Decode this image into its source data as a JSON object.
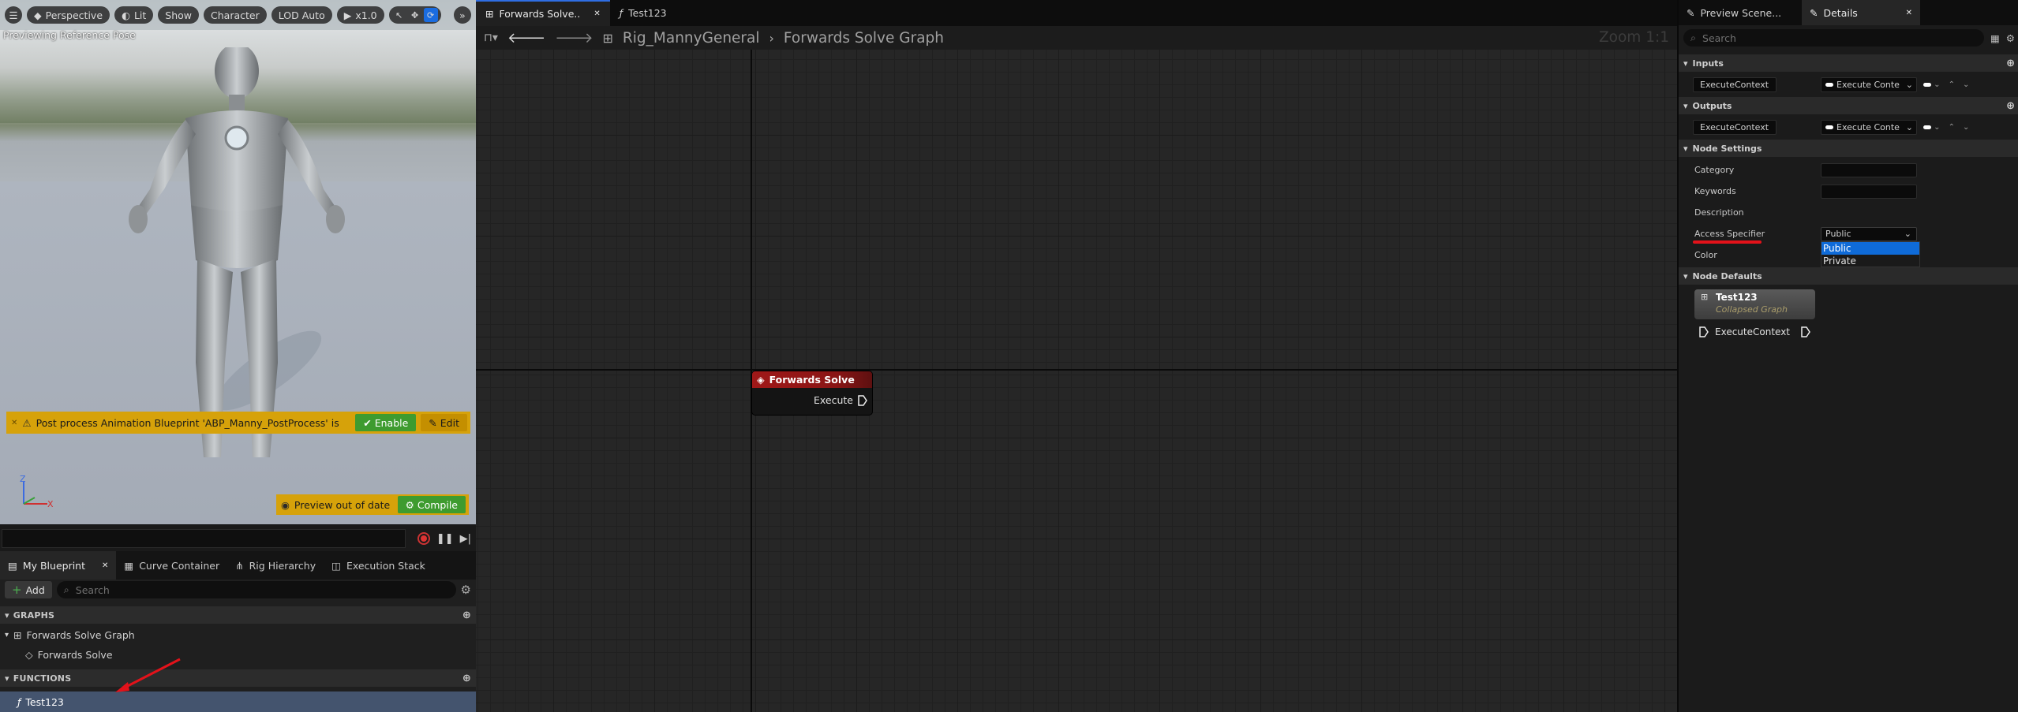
{
  "viewport": {
    "toolbar": {
      "menu_icon": "hamburger-icon",
      "perspective": "Perspective",
      "lit": "Lit",
      "show": "Show",
      "character": "Character",
      "lod": "LOD Auto",
      "speed": "x1.0"
    },
    "preview_label": "Previewing Reference Pose",
    "warning": {
      "text": "Post process Animation Blueprint 'ABP_Manny_PostProcess' is",
      "enable": "Enable",
      "edit": "Edit"
    },
    "preview_out_of_date": {
      "text": "Preview out of date",
      "compile": "Compile"
    },
    "axis": {
      "z": "Z",
      "x": "X"
    },
    "colors": {
      "warning": "#d6a20a",
      "compile": "#3e9b2f"
    }
  },
  "my_blueprint": {
    "tabs": [
      {
        "label": "My Blueprint",
        "icon": "blueprint-icon"
      },
      {
        "label": "Curve Container",
        "icon": "curve-icon"
      },
      {
        "label": "Rig Hierarchy",
        "icon": "hierarchy-icon"
      },
      {
        "label": "Execution Stack",
        "icon": "stack-icon"
      }
    ],
    "add_label": "Add",
    "search_placeholder": "Search",
    "graphs_header": "GRAPHS",
    "graph_items": [
      "Forwards Solve Graph",
      "Forwards Solve"
    ],
    "functions_header": "FUNCTIONS",
    "function_items": [
      "Test123"
    ]
  },
  "graph": {
    "tabs": [
      {
        "label": "Forwards Solve..",
        "icon": "graph-icon"
      },
      {
        "label": "Test123",
        "icon": "function-icon"
      }
    ],
    "breadcrumb_parent": "Rig_MannyGeneral",
    "breadcrumb_current": "Forwards Solve Graph",
    "zoom": "Zoom 1:1",
    "node": {
      "title": "Forwards Solve",
      "pin": "Execute",
      "color": "#a01818"
    }
  },
  "details": {
    "tabs": [
      {
        "label": "Preview Scene...",
        "icon": "pencil-icon"
      },
      {
        "label": "Details",
        "icon": "details-icon"
      }
    ],
    "search_placeholder": "Search",
    "inputs_header": "Inputs",
    "input_name": "ExecuteContext",
    "input_type": "Execute Conte",
    "outputs_header": "Outputs",
    "output_name": "ExecuteContext",
    "output_type": "Execute Conte",
    "node_settings_header": "Node Settings",
    "category_label": "Category",
    "keywords_label": "Keywords",
    "description_label": "Description",
    "access_specifier_label": "Access Specifier",
    "access_specifier_value": "Public",
    "access_options": [
      "Public",
      "Private"
    ],
    "color_label": "Color",
    "node_defaults_header": "Node Defaults",
    "preview_node_title": "Test123",
    "preview_node_subtitle": "Collapsed Graph",
    "preview_node_pin": "ExecuteContext"
  }
}
